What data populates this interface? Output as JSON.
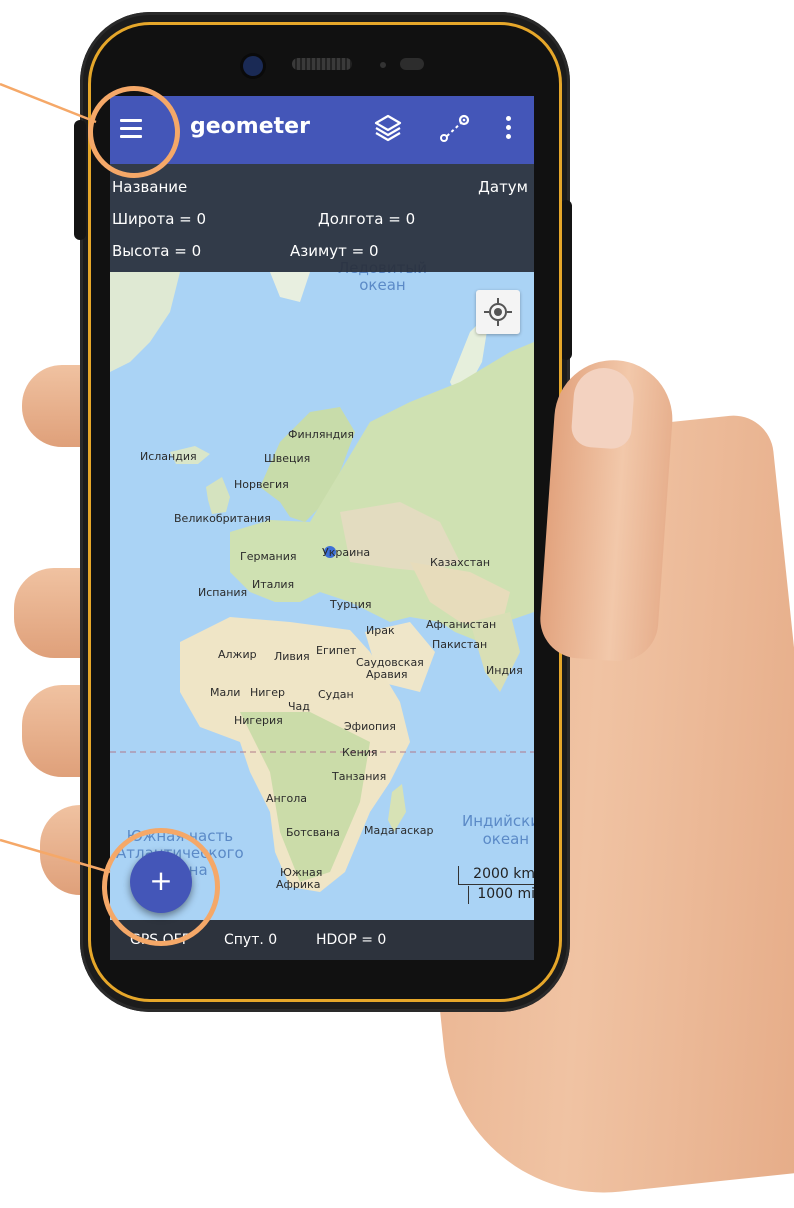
{
  "appbar": {
    "title": "geometer",
    "menu_icon": "hamburger-menu-icon",
    "layers_icon": "layers-icon",
    "route_icon": "route-points-icon",
    "more_icon": "more-vert-icon",
    "color": "#4456b8"
  },
  "info": {
    "name_label": "Название",
    "datum_label": "Датум",
    "latitude": "Широта = 0",
    "longitude": "Долгота = 0",
    "altitude": "Высота = 0",
    "azimuth": "Азимут = 0"
  },
  "map": {
    "ocean_top": [
      "Ледовитый",
      "океан"
    ],
    "ocean_atlantic": [
      "Южная часть",
      "Атлантического",
      "океана"
    ],
    "ocean_indian": [
      "Индийский",
      "океан"
    ],
    "countries": [
      "Финляндия",
      "Исландия",
      "Швеция",
      "Норвегия",
      "Великобритания",
      "Германия",
      "Украина",
      "Казахстан",
      "Испания",
      "Италия",
      "Турция",
      "Ирак",
      "Афганистан",
      "Пакистан",
      "Алжир",
      "Ливия",
      "Египет",
      "Саудовская",
      "Аравия",
      "Индия",
      "Мали",
      "Нигер",
      "Чад",
      "Судан",
      "Нигерия",
      "Эфиопия",
      "Кения",
      "Танзания",
      "Ангола",
      "Ботсвана",
      "Мадагаскар",
      "Южная",
      "Африка"
    ],
    "scale_km": "2000 km",
    "scale_mi": "1000 mi",
    "locate_icon": "my-location-icon"
  },
  "statusbar": {
    "gps": "GPS OFF",
    "satellites": "Спут. 0",
    "hdop": "HDOP = 0"
  },
  "fab": {
    "label": "+"
  },
  "accent": "#f5a868"
}
